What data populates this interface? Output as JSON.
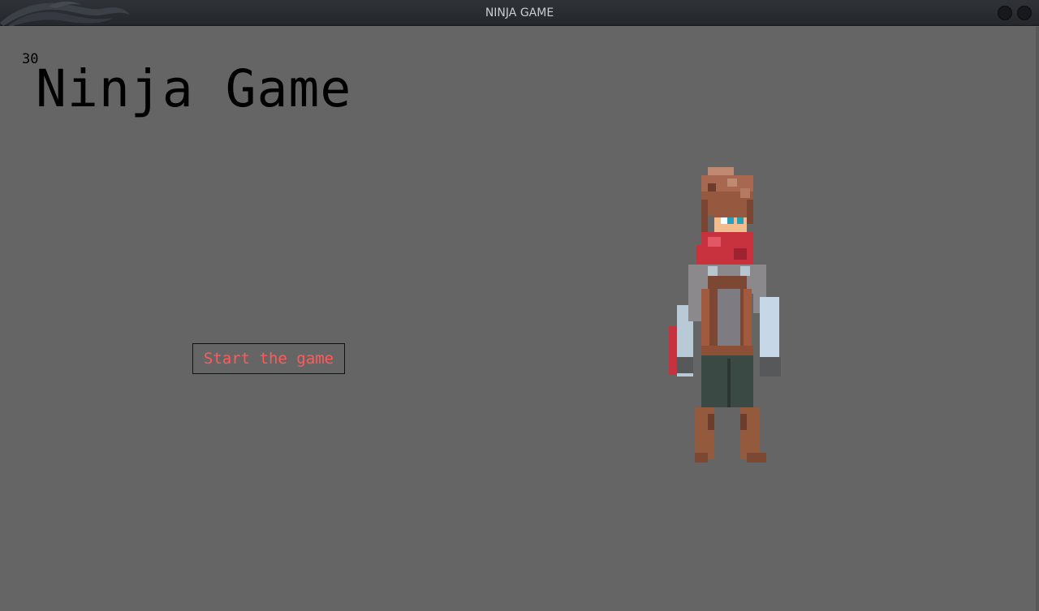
{
  "window": {
    "title": "NINJA GAME"
  },
  "hud": {
    "fps": "30"
  },
  "menu": {
    "title": "Ninja Game",
    "start_label": "Start the game"
  },
  "colors": {
    "background": "#656565",
    "title_text": "#000000",
    "button_text": "#ff5b5b",
    "titlebar": "#2b2f33"
  },
  "icons": {
    "titlebar_logo": "dragon-logo-icon",
    "minimize": "minimize-circle-icon",
    "close": "close-circle-icon"
  }
}
